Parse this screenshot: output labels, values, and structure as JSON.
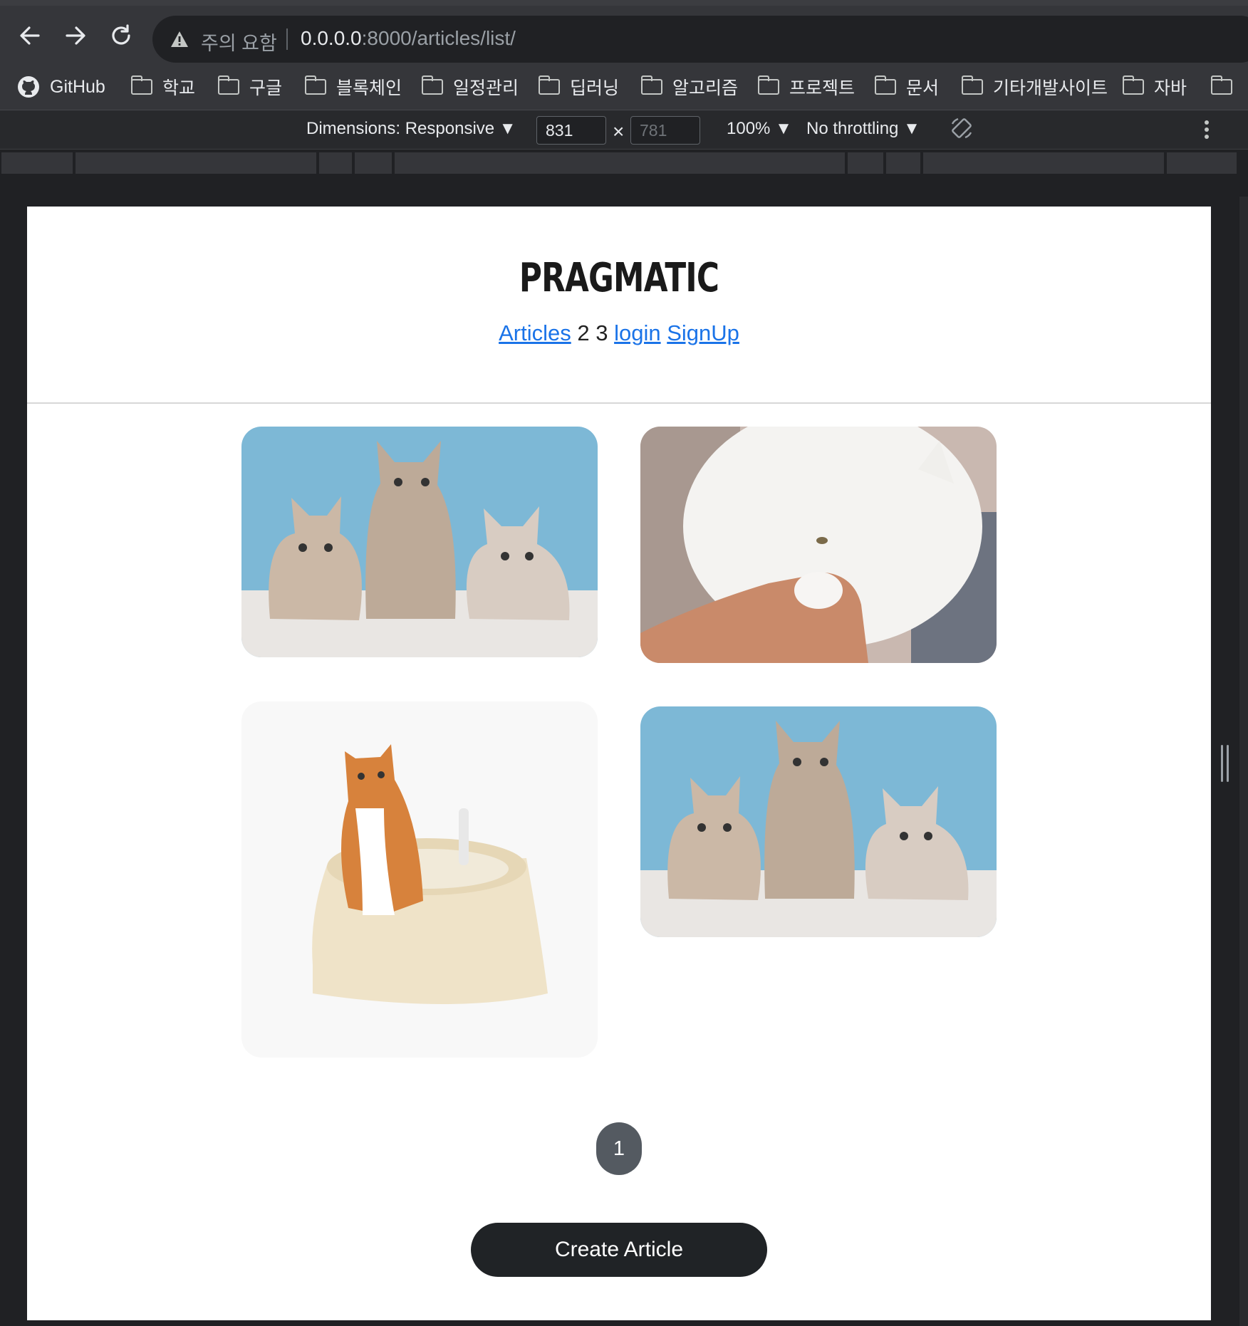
{
  "browser": {
    "nav": {
      "back_icon": "arrow-left-icon",
      "forward_icon": "arrow-right-icon",
      "reload_icon": "reload-icon"
    },
    "security_label": "주의 요함",
    "url_host": "0.0.0.0",
    "url_rest": ":8000/articles/list/",
    "bookmarks": [
      "GitHub",
      "학교",
      "구글",
      "블록체인",
      "일정관리",
      "딥러닝",
      "알고리즘",
      "프로젝트",
      "문서",
      "기타개발사이트",
      "자바"
    ]
  },
  "devtools": {
    "dimensions_label": "Dimensions: Responsive",
    "width_value": "831",
    "times": "×",
    "height_value": "781",
    "zoom_label": "100%",
    "throttle_label": "No throttling"
  },
  "page": {
    "brand": "PRAGMATIC",
    "nav": {
      "articles": "Articles",
      "item2": "2",
      "item3": "3",
      "login": "login",
      "signup": "SignUp"
    },
    "cards": [
      {
        "image": "three-kittens-photo"
      },
      {
        "image": "white-cat-hand-photo"
      },
      {
        "image": "cat-litter-box-photo"
      },
      {
        "image": "three-kittens-photo"
      }
    ],
    "pagination": [
      "1"
    ],
    "create_button": "Create Article"
  },
  "colors": {
    "link": "#1a73e8",
    "button_bg": "#202326",
    "pager_bg": "#545a61",
    "sky_blue": "#7db8d6"
  }
}
